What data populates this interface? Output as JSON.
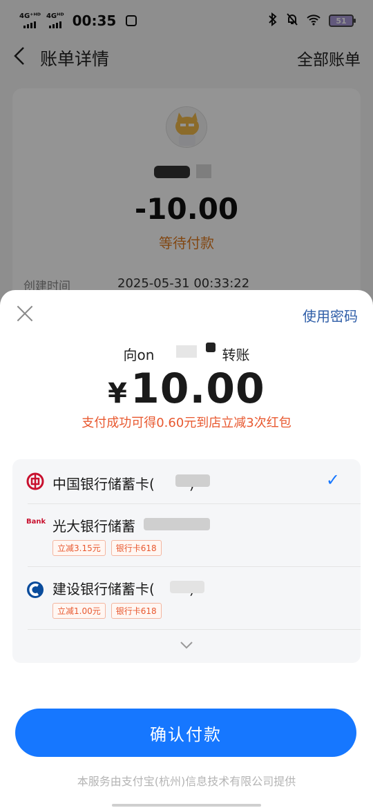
{
  "status_bar": {
    "net1": "4G⁺ᴴᴰ",
    "net2": "4Gᴴᴰ",
    "time": "00:35",
    "battery": "51"
  },
  "header": {
    "title": "账单详情",
    "right_link": "全部账单"
  },
  "bill": {
    "amount": "-10.00",
    "status": "等待付款",
    "created_label": "创建时间",
    "created_value": "2025-05-31 00:33:22"
  },
  "payment": {
    "use_password": "使用密码",
    "transfer_prefix": "向on",
    "transfer_suffix": "转账",
    "currency": "¥",
    "amount": "10.00",
    "promo": "支付成功可得0.60元到店立减3次红包",
    "cards": [
      {
        "name": "中国银行储蓄卡(",
        "suffix": ")",
        "selected": true,
        "tags": []
      },
      {
        "name": "光大银行储蓄",
        "suffix": "",
        "selected": false,
        "tags": [
          "立减3.15元",
          "银行卡618"
        ]
      },
      {
        "name": "建设银行储蓄卡(",
        "suffix": ")",
        "selected": false,
        "tags": [
          "立减1.00元",
          "银行卡618"
        ]
      }
    ],
    "confirm": "确认付款",
    "footer": "本服务由支付宝(杭州)信息技术有限公司提供"
  },
  "colors": {
    "accent": "#1677ff",
    "promo": "#e8582f",
    "pending": "#e07a1f"
  }
}
